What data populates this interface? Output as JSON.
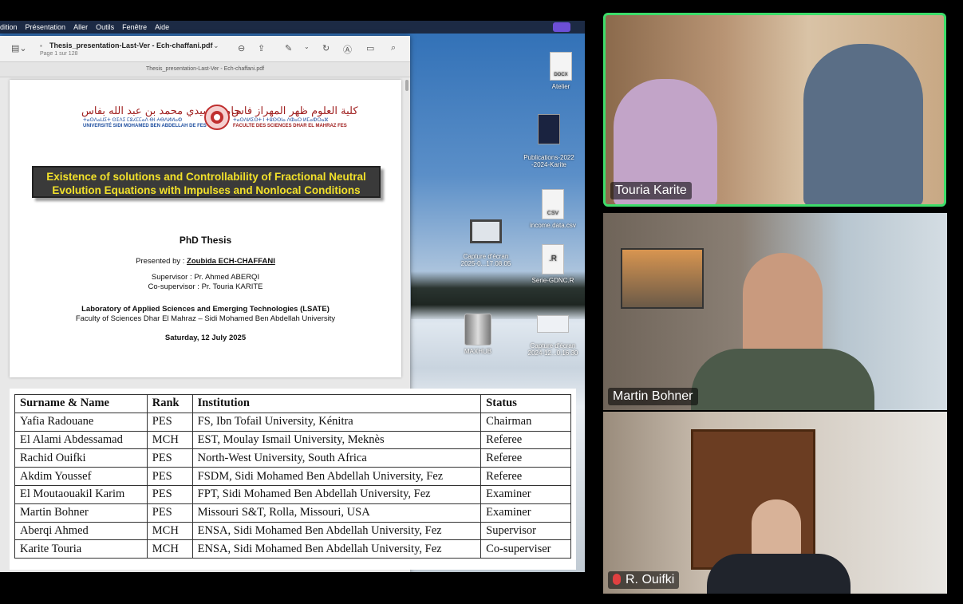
{
  "menubar": [
    "dition",
    "Présentation",
    "Aller",
    "Outils",
    "Fenêtre",
    "Aide"
  ],
  "preview": {
    "filename": "Thesis_presentation-Last-Ver - Ech-chaffani.pdf",
    "page_info": "Page 1 sur 128",
    "tab_title": "Thesis_presentation-Last-Ver - Ech-chaffani.pdf"
  },
  "slide": {
    "univ_left_arabic": "جامعة سيدي محمد بن عبد الله بفاس",
    "univ_left_tifinagh": "ⵜⴰⵙⴷⴰⵡⵉⵜ ⵙⵉⴷⵉ ⵎⵓⵃⵎⵎⴰⴷ ⴱⵏ ⵄⴱⴷⵍⵍⴰⵀ",
    "univ_left": "UNIVERSITÉ SIDI MOHAMED BEN ABDELLAH DE FES",
    "univ_right_arabic": "كلية العلوم ظهر المهراز فاس",
    "univ_right_tifinagh": "ⵜⴰⵙⴷⵍⵉⵙⵜ ⵏ ⵜⵓⵙⵙⵏⴰ ⴷⵀⴰⵔ ⵍⵎⴰⵀⵔⴰⵣ",
    "univ_right": "FACULTE DES SCIENCES DHAR EL MAHRAZ FES",
    "title_line1": "Existence of solutions and Controllability of Fractional Neutral",
    "title_line2": "Evolution Equations with Impulses and Nonlocal Conditions",
    "thesis_type": "PhD Thesis",
    "presented_by_label": "Presented by : ",
    "presenter": "Zoubida ECH-CHAFFANI",
    "supervisor": "Supervisor : Pr. Ahmed ABERQI",
    "cosupervisor": "Co-supervisor : Pr. Touria KARITE",
    "lab": "Laboratory of Applied Sciences and Emerging Technologies (LSATE)",
    "faculty": "Faculty of Sciences Dhar El Mahraz – Sidi Mohamed Ben Abdellah University",
    "date": "Saturday, 12 July 2025"
  },
  "desktop_icons": [
    {
      "label": "Atelier",
      "badge": "DOCX"
    },
    {
      "label": "Publications-2022\n-2024-Karite",
      "badge": ""
    },
    {
      "label": "income.data.csv",
      "badge": "CSV"
    },
    {
      "label": "Capture d'écran\n2025-0...17.08.05",
      "badge": ""
    },
    {
      "label": "Serie-GDNC.R",
      "badge": ".R"
    },
    {
      "label": "MAXHUB",
      "badge": ""
    },
    {
      "label": "Capture d'écran\n2024-12...0.16.30",
      "badge": ""
    }
  ],
  "committee": {
    "headers": [
      "Surname & Name",
      "Rank",
      "Institution",
      "Status"
    ],
    "rows": [
      [
        "Yafia Radouane",
        "PES",
        "FS, Ibn Tofail University, Kénitra",
        "Chairman"
      ],
      [
        "El Alami Abdessamad",
        "MCH",
        "EST, Moulay Ismail University, Meknès",
        "Referee"
      ],
      [
        "Rachid Ouifki",
        "PES",
        "North-West University, South Africa",
        "Referee"
      ],
      [
        "Akdim Youssef",
        "PES",
        "FSDM, Sidi Mohamed Ben Abdellah University, Fez",
        "Referee"
      ],
      [
        "El Moutaouakil Karim",
        "PES",
        "FPT, Sidi Mohamed Ben Abdellah University, Fez",
        "Examiner"
      ],
      [
        "Martin Bohner",
        "PES",
        "Missouri S&T, Rolla, Missouri, USA",
        "Examiner"
      ],
      [
        "Aberqi Ahmed",
        "MCH",
        "ENSA, Sidi Mohamed Ben Abdellah University, Fez",
        "Supervisor"
      ],
      [
        "Karite Touria",
        "MCH",
        "ENSA, Sidi Mohamed Ben Abdellah University, Fez",
        "Co-superviser"
      ]
    ]
  },
  "participants": [
    {
      "name": "Touria Karite",
      "active_speaker": true,
      "muted": false
    },
    {
      "name": "Martin Bohner",
      "active_speaker": false,
      "muted": false
    },
    {
      "name": "R. Ouifki",
      "active_speaker": false,
      "muted": true
    }
  ],
  "colors": {
    "active_speaker_border": "#3ddc6a",
    "slide_title_text": "#f2e12a",
    "slide_title_bg": "#3a3a3a",
    "menubar_bg": "#1c2a44"
  }
}
